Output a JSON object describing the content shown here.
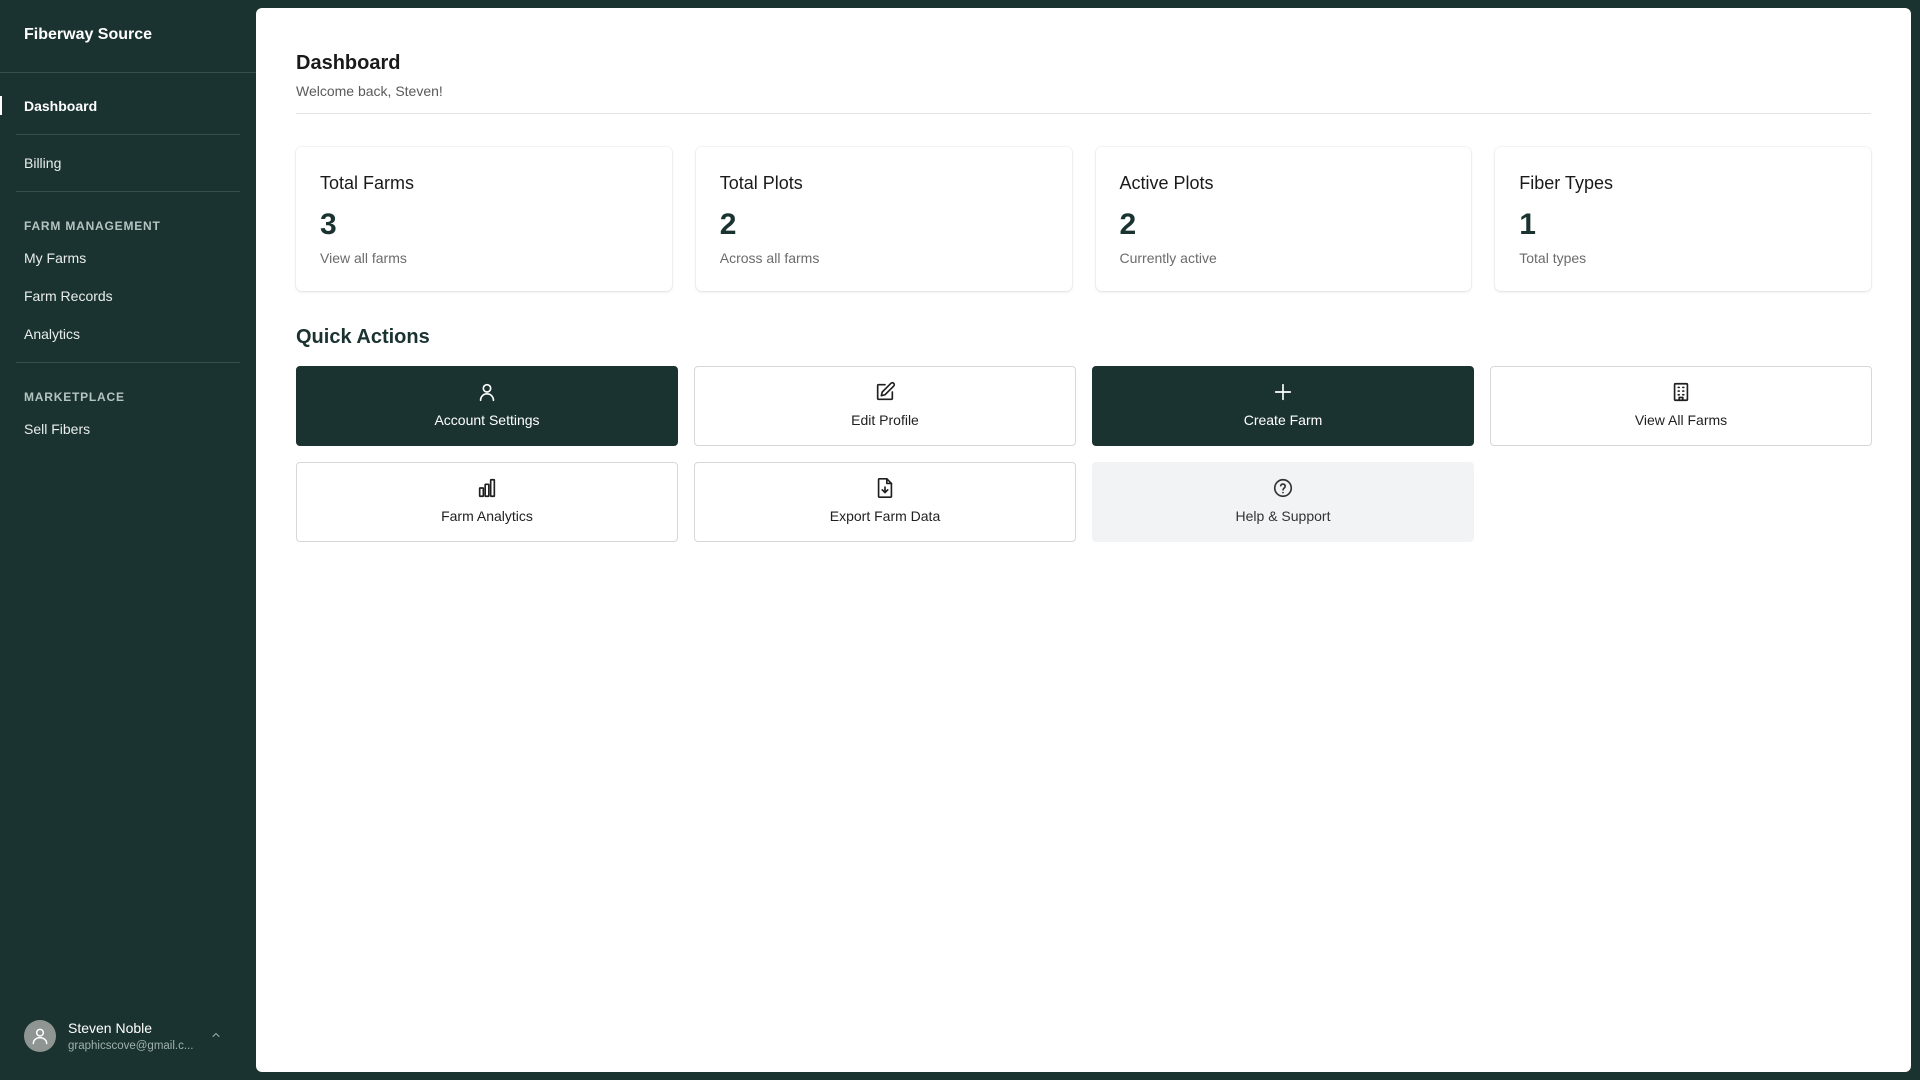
{
  "brand": "Fiberway Source",
  "nav": {
    "dashboard": "Dashboard",
    "billing": "Billing",
    "farm_management_heading": "FARM MANAGEMENT",
    "my_farms": "My Farms",
    "farm_records": "Farm Records",
    "analytics": "Analytics",
    "marketplace_heading": "MARKETPLACE",
    "sell_fibers": "Sell Fibers"
  },
  "user": {
    "name": "Steven Noble",
    "email": "graphicscove@gmail.c..."
  },
  "header": {
    "title": "Dashboard",
    "subtitle": "Welcome back, Steven!"
  },
  "stats": [
    {
      "label": "Total Farms",
      "value": "3",
      "sub": "View all farms"
    },
    {
      "label": "Total Plots",
      "value": "2",
      "sub": "Across all farms"
    },
    {
      "label": "Active Plots",
      "value": "2",
      "sub": "Currently active"
    },
    {
      "label": "Fiber Types",
      "value": "1",
      "sub": "Total types"
    }
  ],
  "quick_actions": {
    "title": "Quick Actions",
    "items": [
      {
        "label": "Account Settings",
        "icon": "user-icon"
      },
      {
        "label": "Edit Profile",
        "icon": "edit-icon"
      },
      {
        "label": "Create Farm",
        "icon": "plus-icon"
      },
      {
        "label": "View All Farms",
        "icon": "building-icon"
      },
      {
        "label": "Farm Analytics",
        "icon": "bar-chart-icon"
      },
      {
        "label": "Export Farm Data",
        "icon": "file-download-icon"
      },
      {
        "label": "Help & Support",
        "icon": "help-circle-icon"
      }
    ]
  },
  "colors": {
    "sidebar_bg": "#1b3330",
    "accent_dark": "#1b3330",
    "content_bg": "#ffffff"
  }
}
